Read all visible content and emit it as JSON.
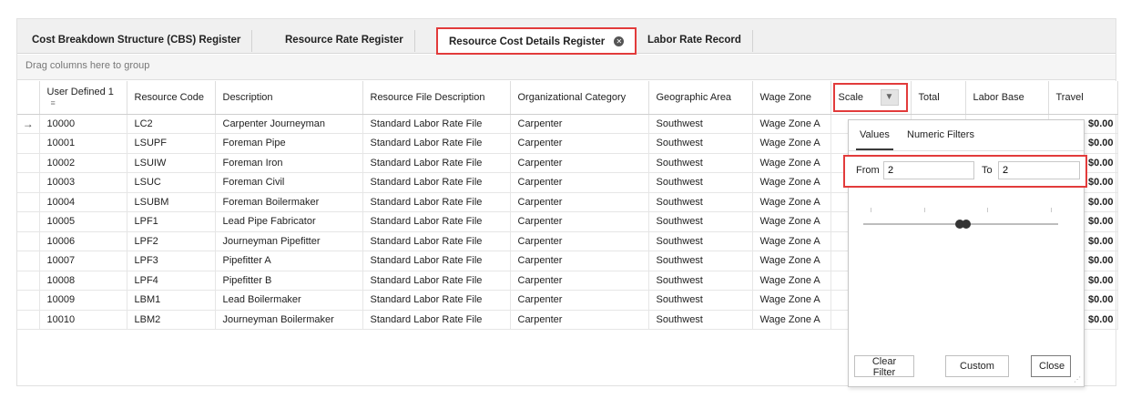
{
  "tabs": [
    {
      "label": "Cost Breakdown Structure (CBS) Register"
    },
    {
      "label": "Resource Rate Register"
    },
    {
      "label": "Resource Cost Details Register"
    },
    {
      "label": "Labor Rate Record"
    }
  ],
  "group_hint": "Drag columns here to group",
  "columns": [
    {
      "label": "User Defined 1"
    },
    {
      "label": "Resource Code"
    },
    {
      "label": "Description"
    },
    {
      "label": "Resource File Description"
    },
    {
      "label": "Organizational Category"
    },
    {
      "label": "Geographic Area"
    },
    {
      "label": "Wage Zone"
    },
    {
      "label": "Scale"
    },
    {
      "label": "Total"
    },
    {
      "label": "Labor Base"
    },
    {
      "label": "Travel"
    }
  ],
  "current_row_indicator": "→",
  "rows": [
    {
      "user_defined_1": "10000",
      "code": "LC2",
      "description": "Carpenter Journeyman",
      "file_desc": "Standard Labor Rate File",
      "category": "Carpenter",
      "area": "Southwest",
      "zone": "Wage Zone A",
      "travel": "$0.00"
    },
    {
      "user_defined_1": "10001",
      "code": "LSUPF",
      "description": "Foreman Pipe",
      "file_desc": "Standard Labor Rate File",
      "category": "Carpenter",
      "area": "Southwest",
      "zone": "Wage Zone A",
      "travel": "$0.00"
    },
    {
      "user_defined_1": "10002",
      "code": "LSUIW",
      "description": "Foreman Iron",
      "file_desc": "Standard Labor Rate File",
      "category": "Carpenter",
      "area": "Southwest",
      "zone": "Wage Zone A",
      "travel": "$0.00"
    },
    {
      "user_defined_1": "10003",
      "code": "LSUC",
      "description": "Foreman Civil",
      "file_desc": "Standard Labor Rate File",
      "category": "Carpenter",
      "area": "Southwest",
      "zone": "Wage Zone A",
      "travel": "$0.00"
    },
    {
      "user_defined_1": "10004",
      "code": "LSUBM",
      "description": "Foreman Boilermaker",
      "file_desc": "Standard Labor Rate File",
      "category": "Carpenter",
      "area": "Southwest",
      "zone": "Wage Zone A",
      "travel": "$0.00"
    },
    {
      "user_defined_1": "10005",
      "code": "LPF1",
      "description": "Lead Pipe Fabricator",
      "file_desc": "Standard Labor Rate File",
      "category": "Carpenter",
      "area": "Southwest",
      "zone": "Wage Zone A",
      "travel": "$0.00"
    },
    {
      "user_defined_1": "10006",
      "code": "LPF2",
      "description": "Journeyman Pipefitter",
      "file_desc": "Standard Labor Rate File",
      "category": "Carpenter",
      "area": "Southwest",
      "zone": "Wage Zone A",
      "travel": "$0.00"
    },
    {
      "user_defined_1": "10007",
      "code": "LPF3",
      "description": "Pipefitter A",
      "file_desc": "Standard Labor Rate File",
      "category": "Carpenter",
      "area": "Southwest",
      "zone": "Wage Zone A",
      "travel": "$0.00"
    },
    {
      "user_defined_1": "10008",
      "code": "LPF4",
      "description": "Pipefitter B",
      "file_desc": "Standard Labor Rate File",
      "category": "Carpenter",
      "area": "Southwest",
      "zone": "Wage Zone A",
      "travel": "$0.00"
    },
    {
      "user_defined_1": "10009",
      "code": "LBM1",
      "description": "Lead Boilermaker",
      "file_desc": "Standard Labor Rate File",
      "category": "Carpenter",
      "area": "Southwest",
      "zone": "Wage Zone A",
      "travel": "$0.00"
    },
    {
      "user_defined_1": "10010",
      "code": "LBM2",
      "description": "Journeyman Boilermaker",
      "file_desc": "Standard Labor Rate File",
      "category": "Carpenter",
      "area": "Southwest",
      "zone": "Wage Zone A",
      "travel": "$0.00"
    }
  ],
  "filter_popup": {
    "tabs": [
      "Values",
      "Numeric Filters"
    ],
    "from_label": "From",
    "from_value": "2",
    "to_label": "To",
    "to_value": "2",
    "buttons": {
      "clear": "Clear Filter",
      "custom": "Custom",
      "close": "Close"
    }
  },
  "icons": {
    "tab_close": "close-circle-icon",
    "sort": "sort-icon",
    "filter": "funnel-filter-icon",
    "row_indicator": "arrow-right-icon",
    "resize_grip": "resize-grip-icon"
  },
  "colors": {
    "highlight": "#e23b3b",
    "tabbar_bg": "#f0f0f0"
  }
}
